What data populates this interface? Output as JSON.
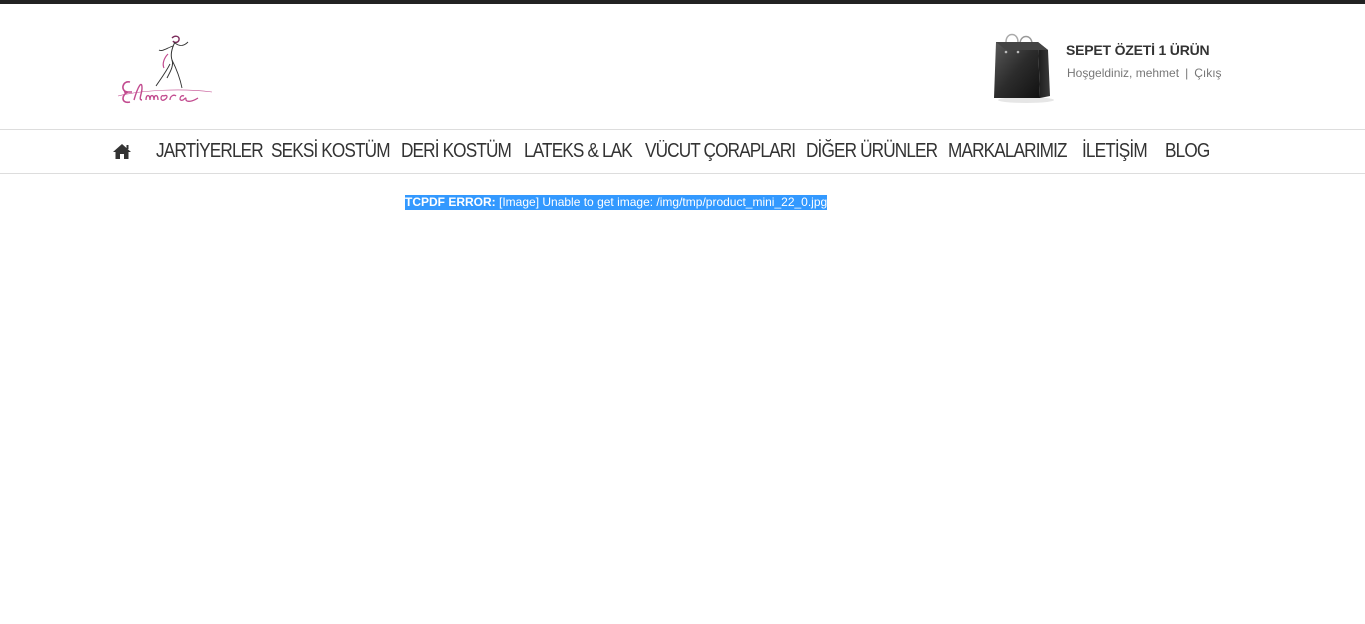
{
  "header": {
    "logo_alt": "Elmora",
    "cart_title": "SEPET ÖZETİ 1 ÜRÜN",
    "welcome": "Hoşgeldiniz, mehmet",
    "separator": "|",
    "logout": "Çıkış"
  },
  "nav": {
    "home_icon": "home-icon",
    "items": [
      "JARTİYERLER",
      "SEKSİ KOSTÜM",
      "DERİ KOSTÜM",
      "LATEKS & LAK",
      "VÜCUT ÇORAPLARI",
      "DİĞER ÜRÜNLER",
      "MARKALARIMIZ",
      "İLETİŞİM",
      "BLOG"
    ]
  },
  "error": {
    "label": "TCPDF ERROR:",
    "message": " [Image] Unable to get image: /img/tmp/product_mini_22_0.jpg"
  },
  "colors": {
    "selection": "#3399ff",
    "text": "#333333",
    "muted": "#777777",
    "logo_pink": "#c24b8f"
  }
}
